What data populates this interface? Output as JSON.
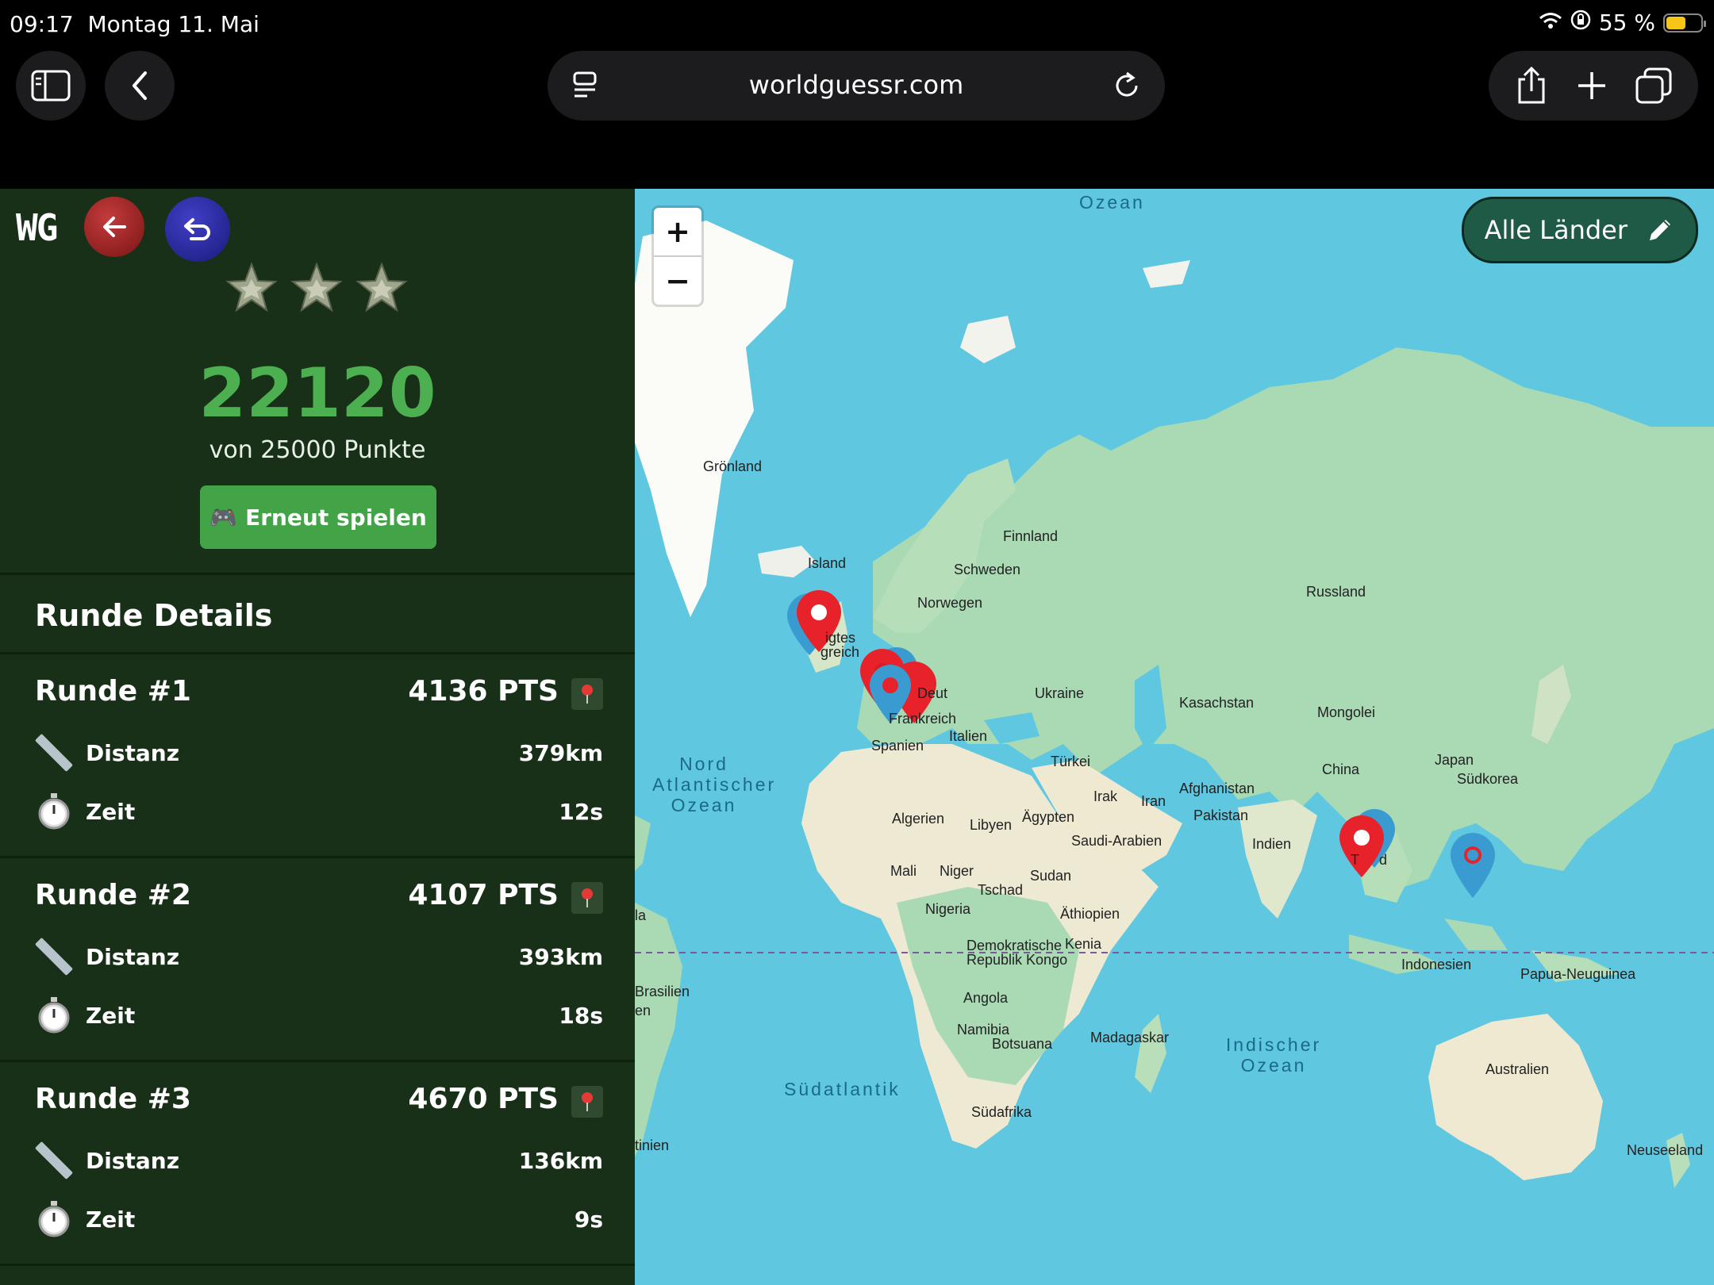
{
  "status_bar": {
    "time": "09:17",
    "date": "Montag 11. Mai",
    "battery": "55 %",
    "battery_level": 0.55
  },
  "browser": {
    "url": "worldguessr.com"
  },
  "app": {
    "logo": "WG",
    "score": "22120",
    "score_of": "von 25000 Punkte",
    "replay_label": "Erneut spielen",
    "replay_icon": "🎮",
    "stars_count": 3,
    "details_title": "Runde Details",
    "rounds": [
      {
        "title": "Runde #1",
        "points": "4136 PTS",
        "distance_label": "Distanz",
        "distance": "379km",
        "time_label": "Zeit",
        "time": "12s"
      },
      {
        "title": "Runde #2",
        "points": "4107 PTS",
        "distance_label": "Distanz",
        "distance": "393km",
        "time_label": "Zeit",
        "time": "18s"
      },
      {
        "title": "Runde #3",
        "points": "4670 PTS",
        "distance_label": "Distanz",
        "distance": "136km",
        "time_label": "Zeit",
        "time": "9s"
      }
    ]
  },
  "map": {
    "zoom_in": "+",
    "zoom_out": "−",
    "filter_label": "Alle Länder",
    "oceans": {
      "arctic": "Ozean",
      "north_atlantic": "Nord\nAtlantischer\nOzean",
      "south_atlantic": "Südatlantik",
      "indian": "Indischer\nOzean"
    },
    "labels": {
      "groenland": "Grönland",
      "island": "Island",
      "finnland": "Finnland",
      "schweden": "Schweden",
      "norwegen": "Norwegen",
      "russland": "Russland",
      "vk1": "igtes",
      "vk2": "greich",
      "deutschland": "Deut",
      "ukraine": "Ukraine",
      "kasachstan": "Kasachstan",
      "mongolei": "Mongolei",
      "frankreich": "Frankreich",
      "italien": "Italien",
      "spanien": "Spanien",
      "tuerkei": "Türkei",
      "japan": "Japan",
      "china": "China",
      "suedkorea": "Südkorea",
      "afghanistan": "Afghanistan",
      "irak": "Irak",
      "iran": "Iran",
      "pakistan": "Pakistan",
      "algerien": "Algerien",
      "libyen": "Libyen",
      "aegypten": "Ägypten",
      "saudi": "Saudi-Arabien",
      "indien": "Indien",
      "thailand1": "T",
      "thailand2": "d",
      "mali": "Mali",
      "niger": "Niger",
      "sudan": "Sudan",
      "tschad": "Tschad",
      "nigeria": "Nigeria",
      "aethiopien": "Äthiopien",
      "kongo1": "Demokratische",
      "kongo2": "Republik Kongo",
      "kenia": "Kenia",
      "indonesien": "Indonesien",
      "png": "Papua-Neuguinea",
      "brasilien": "Brasilien",
      "angola": "Angola",
      "namibia": "Namibia",
      "botsuana": "Botsuana",
      "madagaskar": "Madagaskar",
      "australien": "Australien",
      "suedafrika": "Südafrika",
      "neuseeland": "Neuseeland",
      "edge_la": "la",
      "edge_en": "en",
      "edge_tinien": "tinien"
    }
  },
  "colors": {
    "panel": "#183018",
    "score": "#4caf50",
    "button": "#43a447",
    "ocean": "#5fc7e0",
    "guess_pin": "#e8222b",
    "answer_pin": "#3a9bd0"
  },
  "icons": [
    "sidebar-icon",
    "back-chevron-icon",
    "tabs-icon",
    "reload-icon",
    "share-icon",
    "plus-icon",
    "copy-tabs-icon",
    "arrow-left-icon",
    "undo-icon",
    "star-icon",
    "gamepad-icon",
    "ruler-icon",
    "stopwatch-icon",
    "pin-icon",
    "pencil-icon"
  ]
}
